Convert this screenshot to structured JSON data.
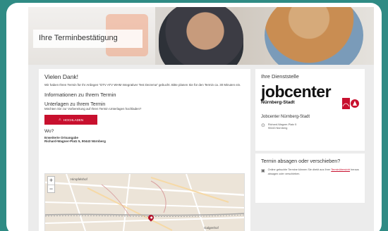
{
  "hero": {
    "title": "Ihre Terminbestätigung"
  },
  "main": {
    "heading": "Vielen Dank!",
    "intro": "Wir haben Ihren Termin für Ihr Anliegen \"DTV ATV WHM Integrativer Test Dezema\" gebucht. Bitte planen Sie für den Termin ca. 30 Minuten ein.",
    "section_title": "Informationen zu Ihrem Termin",
    "documents_title": "Unterlagen zu Ihrem Termin",
    "documents_text": "Möchten Sie zur Vorbereitung auf Ihren Termin Unterlagen hochladen?",
    "upload_label": "HOCHLADEN",
    "where_title": "Wo?",
    "address_line1": "Erweiterte Ortsangabe",
    "address_line2": "Richard-Wagner-Platz 5, 90443 Nürnberg",
    "map": {
      "zoom_in": "+",
      "zoom_out": "−",
      "label_top": "Himpfelshof",
      "label_right": "Galgenhof"
    }
  },
  "office": {
    "heading": "Ihre Dienststelle",
    "logo_word": "jobcenter",
    "logo_sub": "Nürnberg-Stadt",
    "name": "Jobcenter Nürnberg-Stadt",
    "street": "Richard-Wagner-Platz 5",
    "city": "90443 Nürnberg"
  },
  "cancel": {
    "heading": "Termin absagen oder verschieben?",
    "text_before": "Online gebuchte Termine können Sie direkt aus Ihrer ",
    "link_text": "Terminübersicht",
    "text_after": " heraus absagen oder verschieben."
  },
  "colors": {
    "accent": "#c8102e",
    "frame": "#2f8b84"
  }
}
